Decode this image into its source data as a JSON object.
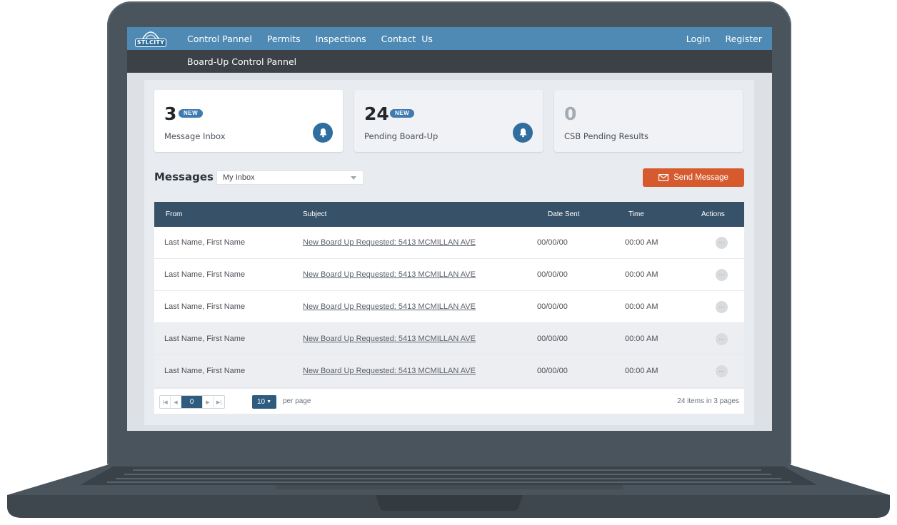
{
  "brand": {
    "logo_text": "STLCITY"
  },
  "nav": {
    "links": [
      "Control Pannel",
      "Permits",
      "Inspections",
      "Contact  Us"
    ],
    "login": "Login",
    "register": "Register"
  },
  "subnav": {
    "title": "Board-Up Control Pannel"
  },
  "cards": [
    {
      "count": "3",
      "badge": "NEW",
      "label": "Message Inbox"
    },
    {
      "count": "24",
      "badge": "NEW",
      "label": "Pending Board-Up"
    },
    {
      "count": "0",
      "label": "CSB Pending Results"
    }
  ],
  "messages": {
    "title": "Messages",
    "filter_value": "My Inbox",
    "send_label": "Send Message",
    "columns": [
      "From",
      "Subject",
      "Date Sent",
      "Time",
      "Actions"
    ],
    "rows": [
      {
        "from": "Last Name, First Name",
        "subject": "New Board Up Requested: 5413 MCMILLAN AVE",
        "date": "00/00/00",
        "time": "00:00 AM",
        "actions": "···"
      },
      {
        "from": "Last Name, First Name",
        "subject": "New Board Up Requested: 5413 MCMILLAN AVE",
        "date": "00/00/00",
        "time": "00:00 AM",
        "actions": "···"
      },
      {
        "from": "Last Name, First Name",
        "subject": "New Board Up Requested: 5413 MCMILLAN AVE",
        "date": "00/00/00",
        "time": "00:00 AM",
        "actions": "···"
      },
      {
        "from": "Last Name, First Name",
        "subject": "New Board Up Requested: 5413 MCMILLAN AVE",
        "date": "00/00/00",
        "time": "00:00 AM",
        "actions": "···"
      },
      {
        "from": "Last Name, First Name",
        "subject": "New Board Up Requested: 5413 MCMILLAN AVE",
        "date": "00/00/00",
        "time": "00:00 AM",
        "actions": "···"
      }
    ]
  },
  "pagination": {
    "current_page": "0",
    "per_page": "10",
    "per_page_label": "per page",
    "summary": "24 items in 3 pages"
  },
  "colors": {
    "nav_bg": "#4f8ab5",
    "subnav_bg": "#3b4147",
    "table_header": "#375168",
    "accent_button": "#d55b2f",
    "badge": "#3f7ab0"
  }
}
